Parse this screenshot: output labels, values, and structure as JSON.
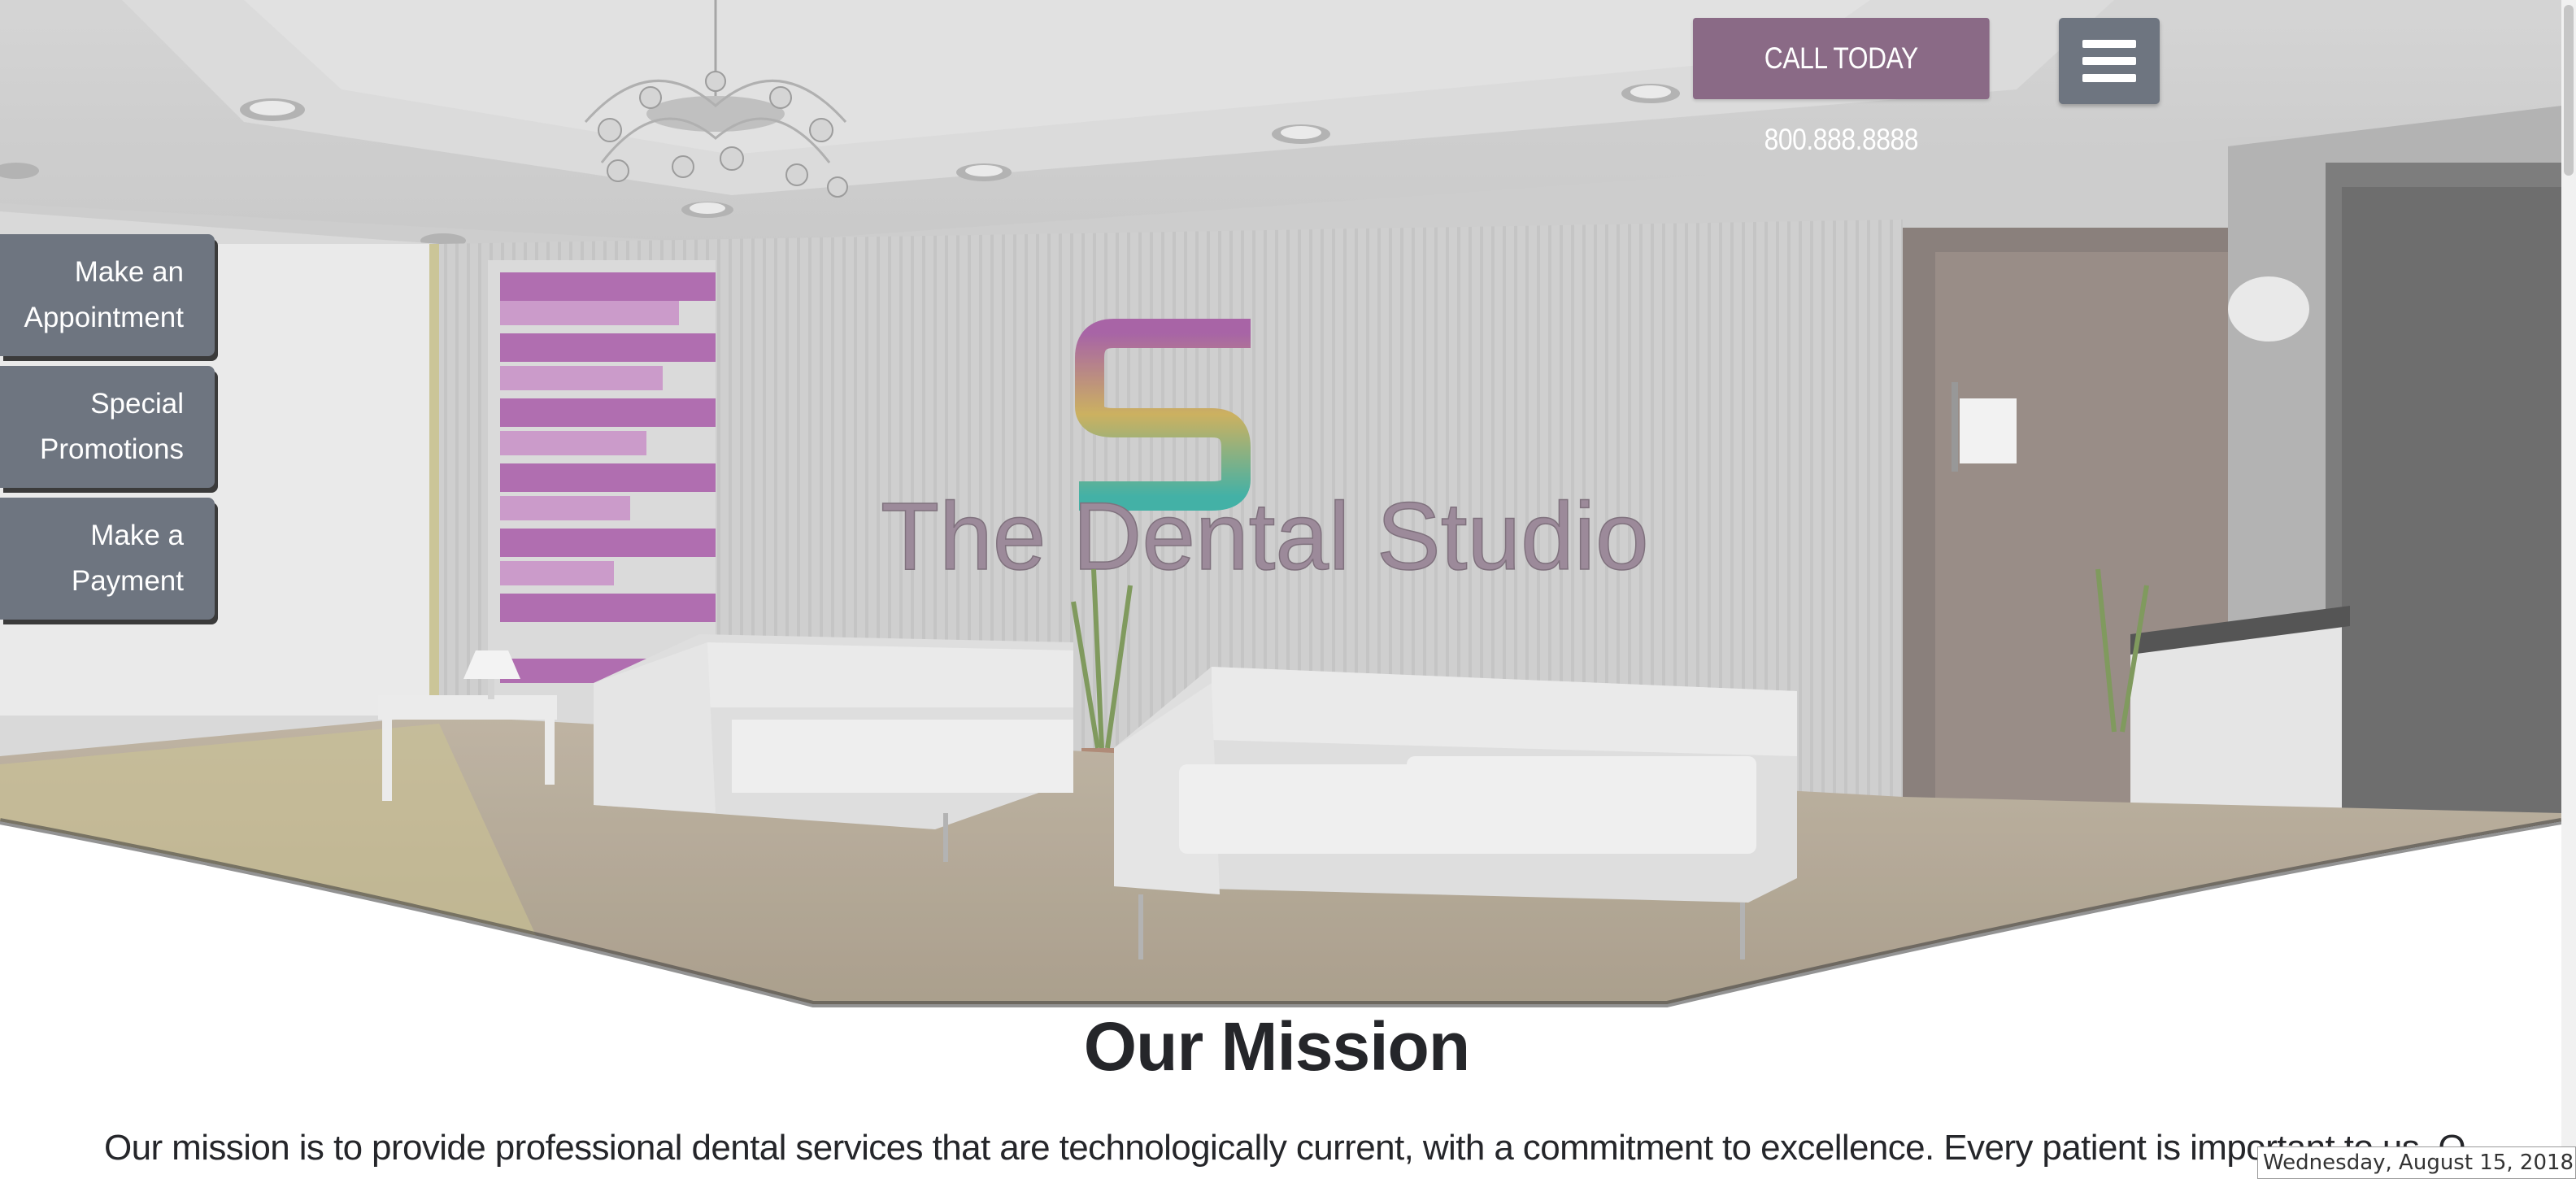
{
  "header": {
    "call_label": "CALL TODAY 800.888.8888",
    "menu_icon": "hamburger-menu-icon"
  },
  "hero": {
    "sign_text": "The Dental Studio",
    "logo_letter": "S"
  },
  "side_tabs": [
    {
      "line1": "Make an",
      "line2": "Appointment"
    },
    {
      "line1": "Special",
      "line2": "Promotions"
    },
    {
      "line1": "Make a",
      "line2": "Payment"
    }
  ],
  "mission": {
    "title": "Our Mission",
    "text": "Our mission is to provide professional dental services that are technologically current, with a commitment to excellence. Every patient is important to us. O"
  },
  "date_overlay": "Wednesday, August 15, 2018",
  "colors": {
    "brand_purple": "#8a6a86",
    "slate_gray": "#6e7580",
    "text_dark": "#25262a",
    "accent_magenta": "#a65aa6"
  }
}
